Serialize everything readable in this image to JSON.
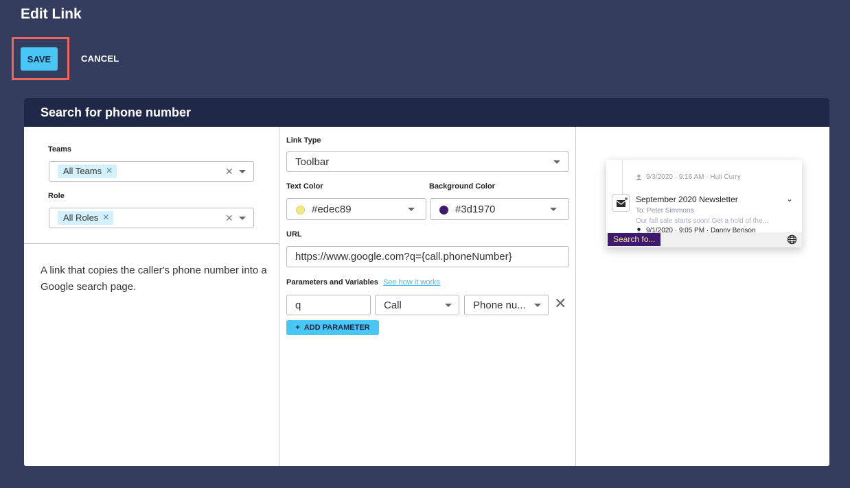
{
  "header": {
    "title": "Edit Link"
  },
  "actions": {
    "save_label": "SAVE",
    "cancel_label": "CANCEL"
  },
  "card": {
    "title": "Search for phone number"
  },
  "left": {
    "teams_label": "Teams",
    "teams_chip": "All Teams",
    "role_label": "Role",
    "role_chip": "All Roles",
    "description": "A link that copies the caller's phone number into a Google search page."
  },
  "middle": {
    "link_type_label": "Link Type",
    "link_type_value": "Toolbar",
    "text_color_label": "Text Color",
    "text_color_value": "#edec89",
    "bg_color_label": "Background Color",
    "bg_color_value": "#3d1970",
    "url_label": "URL",
    "url_value": "https://www.google.com?q={call.phoneNumber}",
    "params_label": "Parameters and Variables",
    "params_link": "See how it works",
    "param": {
      "name": "q",
      "source": "Call",
      "field": "Phone nu..."
    },
    "add_param_label": "ADD PARAMETER"
  },
  "preview": {
    "meta_top": "9/3/2020 · 9:16 AM · Huli Curry",
    "item_title": "September 2020 Newsletter",
    "to_prefix": "To:",
    "to_name": "Peter Simmons",
    "snippet": "Our fall sale starts soon! Get a hold of the...",
    "date": "9/1/2020 · 9:05 PM · Danny Benson",
    "search_tag": "Search fo..."
  },
  "colors": {
    "background": "#353d5e",
    "header_bar": "#1f2846",
    "accent": "#48c7f4",
    "highlight": "#f2665a",
    "text_color_swatch": "#edec89",
    "bg_color_swatch": "#3d1970"
  },
  "icons": [
    "chevron-down-icon",
    "close-icon",
    "plus-icon",
    "mail-icon",
    "person-icon",
    "globe-icon"
  ]
}
